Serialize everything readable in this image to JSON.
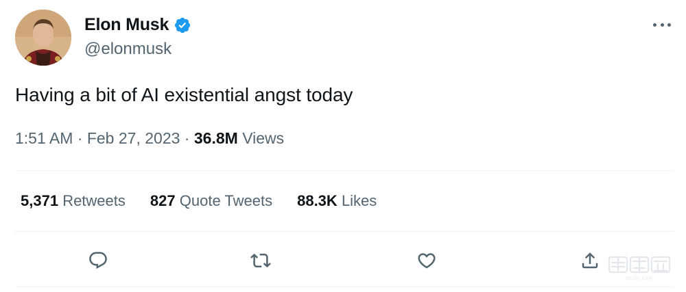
{
  "author": {
    "display_name": "Elon Musk",
    "handle": "@elonmusk",
    "verified": true,
    "avatar_icon": "profile-photo"
  },
  "tweet": {
    "text": "Having a bit of AI existential angst today",
    "time": "1:51 AM",
    "separator1": "·",
    "date": "Feb 27, 2023",
    "separator2": "·",
    "views_count": "36.8M",
    "views_label": "Views"
  },
  "stats": {
    "retweets_count": "5,371",
    "retweets_label": "Retweets",
    "quotes_count": "827",
    "quotes_label": "Quote Tweets",
    "likes_count": "88.3K",
    "likes_label": "Likes"
  },
  "actions": [
    {
      "name": "reply",
      "icon": "speech-bubble-icon"
    },
    {
      "name": "retweet",
      "icon": "retweet-icon"
    },
    {
      "name": "like",
      "icon": "heart-icon"
    },
    {
      "name": "share",
      "icon": "share-upload-icon"
    }
  ],
  "colors": {
    "text_primary": "#0f1419",
    "text_secondary": "#536471",
    "verified_blue": "#1d9bf0",
    "divider": "#eff3f4"
  },
  "watermark": {
    "text": "智东西",
    "subtext": "zhidx.com"
  }
}
